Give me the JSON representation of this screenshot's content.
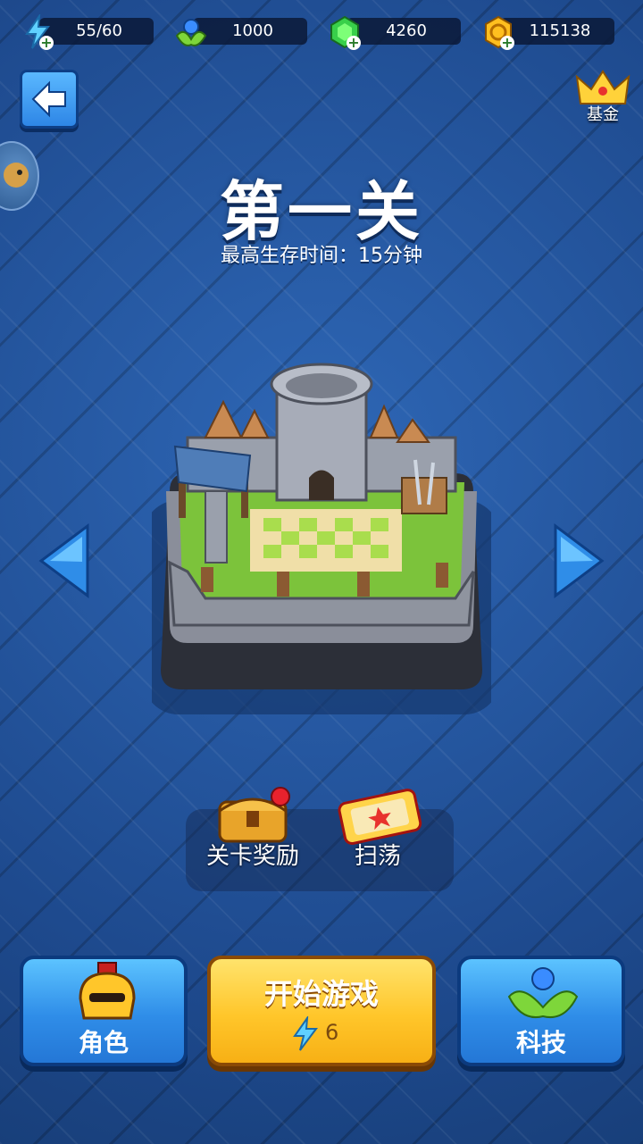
{
  "resources": [
    {
      "name": "energy",
      "value": "55/60",
      "icon": "lightning-icon"
    },
    {
      "name": "seed",
      "value": "1000",
      "icon": "sprout-orb-icon"
    },
    {
      "name": "gem",
      "value": "4260",
      "icon": "green-gem-icon"
    },
    {
      "name": "gold",
      "value": "115138",
      "icon": "gold-coin-icon"
    }
  ],
  "header": {
    "fund_label": "基金"
  },
  "level": {
    "title": "第一关",
    "subtitle": "最高生存时间：15分钟"
  },
  "rewards": {
    "stage_reward_label": "关卡奖励",
    "sweep_label": "扫荡"
  },
  "bottom": {
    "role_label": "角色",
    "start_label": "开始游戏",
    "start_cost": "6",
    "tech_label": "科技"
  },
  "colors": {
    "background": "#1f4f95",
    "button_blue": "#2f8de8",
    "button_yellow": "#ffc62a"
  }
}
